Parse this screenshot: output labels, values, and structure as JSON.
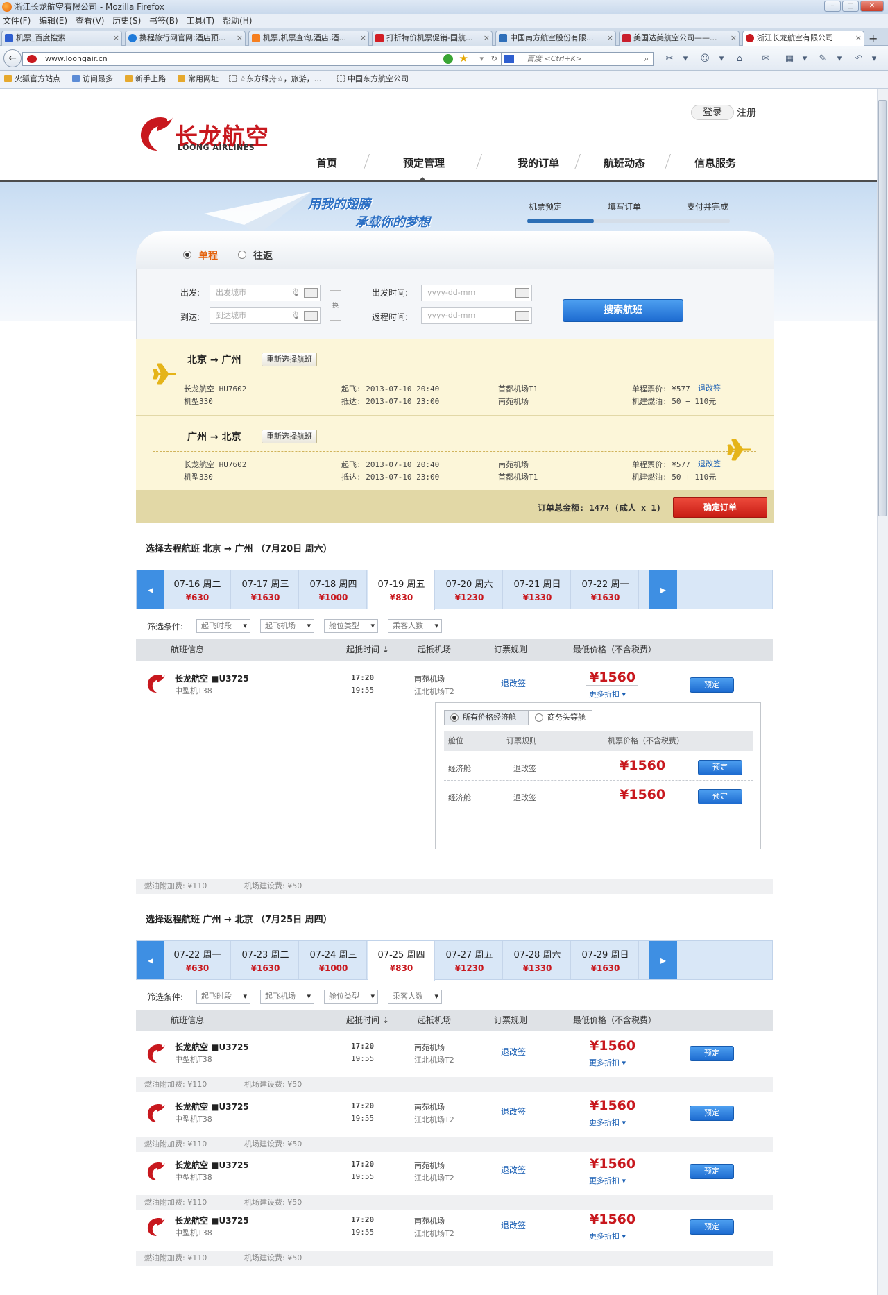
{
  "browser": {
    "title": "浙江长龙航空有限公司 - Mozilla Firefox",
    "menu": [
      "文件(F)",
      "编辑(E)",
      "查看(V)",
      "历史(S)",
      "书签(B)",
      "工具(T)",
      "帮助(H)"
    ],
    "tabs": [
      "机票_百度搜索",
      "携程旅行网官网:酒店预...",
      "机票,机票查询,酒店,酒...",
      "打折特价机票促销-国航...",
      "中国南方航空股份有限...",
      "美国达美航空公司——...",
      "浙江长龙航空有限公司"
    ],
    "url": "www.loongair.cn",
    "search_placeholder": "百度 <Ctrl+K>",
    "bookmarks": [
      "火狐官方站点",
      "访问最多",
      "新手上路",
      "常用网址",
      "☆东方绿舟☆，旅游，...",
      "中国东方航空公司"
    ]
  },
  "site": {
    "logo_cn": "长龙航空",
    "logo_en": "LOONG AIRLINES",
    "login": "登录",
    "register": "注册",
    "nav": [
      "首页",
      "预定管理",
      "我的订单",
      "航班动态",
      "信息服务"
    ],
    "slogan1": "用我的翅膀",
    "slogan2": "承载你的梦想",
    "steps": [
      "机票预定",
      "填写订单",
      "支付并完成"
    ],
    "step_progress_percent": 33
  },
  "search": {
    "one_way": "单程",
    "round_trip": "往返",
    "from_label": "出发:",
    "to_label": "到达:",
    "from_placeholder": "出发城市",
    "to_placeholder": "到达城市",
    "depart_label": "出发时间:",
    "return_label": "返程时间:",
    "date_placeholder": "yyyy-dd-mm",
    "swap": "换",
    "search_btn": "搜索航班"
  },
  "summary": {
    "legs": [
      {
        "from": "北京",
        "to": "广州",
        "reselect": "重新选择航班",
        "airline": "长龙航空 HU7602",
        "model": "机型330",
        "dep": "起飞: 2013-07-10 20:40",
        "arr": "抵达: 2013-07-10 23:00",
        "dep_airport": "首都机场T1",
        "arr_airport": "南苑机场",
        "price": "单程票价: ¥577",
        "change": "退改签",
        "tax": "机建燃油: 50 + 110元"
      },
      {
        "from": "广州",
        "to": "北京",
        "reselect": "重新选择航班",
        "airline": "长龙航空 HU7602",
        "model": "机型330",
        "dep": "起飞: 2013-07-10 20:40",
        "arr": "抵达: 2013-07-10 23:00",
        "dep_airport": "南苑机场",
        "arr_airport": "首都机场T1",
        "price": "单程票价: ¥577",
        "change": "退改签",
        "tax": "机建燃油: 50 + 110元"
      }
    ],
    "total": "订单总金额: 1474 (成人 x 1)",
    "confirm": "确定订单"
  },
  "outbound": {
    "title": "选择去程航班 北京 → 广州 （7月20日 周六）",
    "dates": [
      {
        "d": "07-16 周二",
        "p": "¥630"
      },
      {
        "d": "07-17 周三",
        "p": "¥1630"
      },
      {
        "d": "07-18 周四",
        "p": "¥1000"
      },
      {
        "d": "07-19 周五",
        "p": "¥830"
      },
      {
        "d": "07-20 周六",
        "p": "¥1230"
      },
      {
        "d": "07-21 周日",
        "p": "¥1330"
      },
      {
        "d": "07-22 周一",
        "p": "¥1630"
      }
    ]
  },
  "inbound": {
    "title": "选择返程航班 广州 → 北京 （7月25日 周四）",
    "dates": [
      {
        "d": "07-22 周一",
        "p": "¥630"
      },
      {
        "d": "07-23 周二",
        "p": "¥1630"
      },
      {
        "d": "07-24 周三",
        "p": "¥1000"
      },
      {
        "d": "07-25 周四",
        "p": "¥830"
      },
      {
        "d": "07-27 周五",
        "p": "¥1230"
      },
      {
        "d": "07-28 周六",
        "p": "¥1330"
      },
      {
        "d": "07-29 周日",
        "p": "¥1630"
      }
    ]
  },
  "filters": {
    "label": "筛选条件:",
    "opts": [
      "起飞时段",
      "起飞机场",
      "舱位类型",
      "乘客人数"
    ]
  },
  "table_head": [
    "航班信息",
    "起抵时间 ⇣",
    "起抵机场",
    "订票规则",
    "最低价格（不含税费）"
  ],
  "flight": {
    "name": "长龙航空 ■U3725",
    "model": "中型机T38",
    "dep_time": "17:20",
    "arr_time": "19:55",
    "dep_airport": "南苑机场",
    "arr_airport": "江北机场T2",
    "rule": "退改签",
    "price": "¥1560",
    "more": "更多折扣 ▾",
    "book": "预定",
    "fuel": "燃油附加费: ¥110",
    "airport_fee": "机场建设费: ¥50"
  },
  "popup": {
    "tab1": "所有价格经济舱",
    "tab2": "商务头等舱",
    "cols": [
      "舱位",
      "订票规则",
      "机票价格（不含税费）"
    ],
    "rows": [
      {
        "cabin": "经济舱",
        "rule": "退改签",
        "price": "¥1560",
        "book": "预定"
      },
      {
        "cabin": "经济舱",
        "rule": "退改签",
        "price": "¥1560",
        "book": "预定"
      }
    ]
  },
  "colors": {
    "brand_red": "#c8181e",
    "accent_blue": "#2c6eb5",
    "summary_bg": "#fcf6d9"
  }
}
